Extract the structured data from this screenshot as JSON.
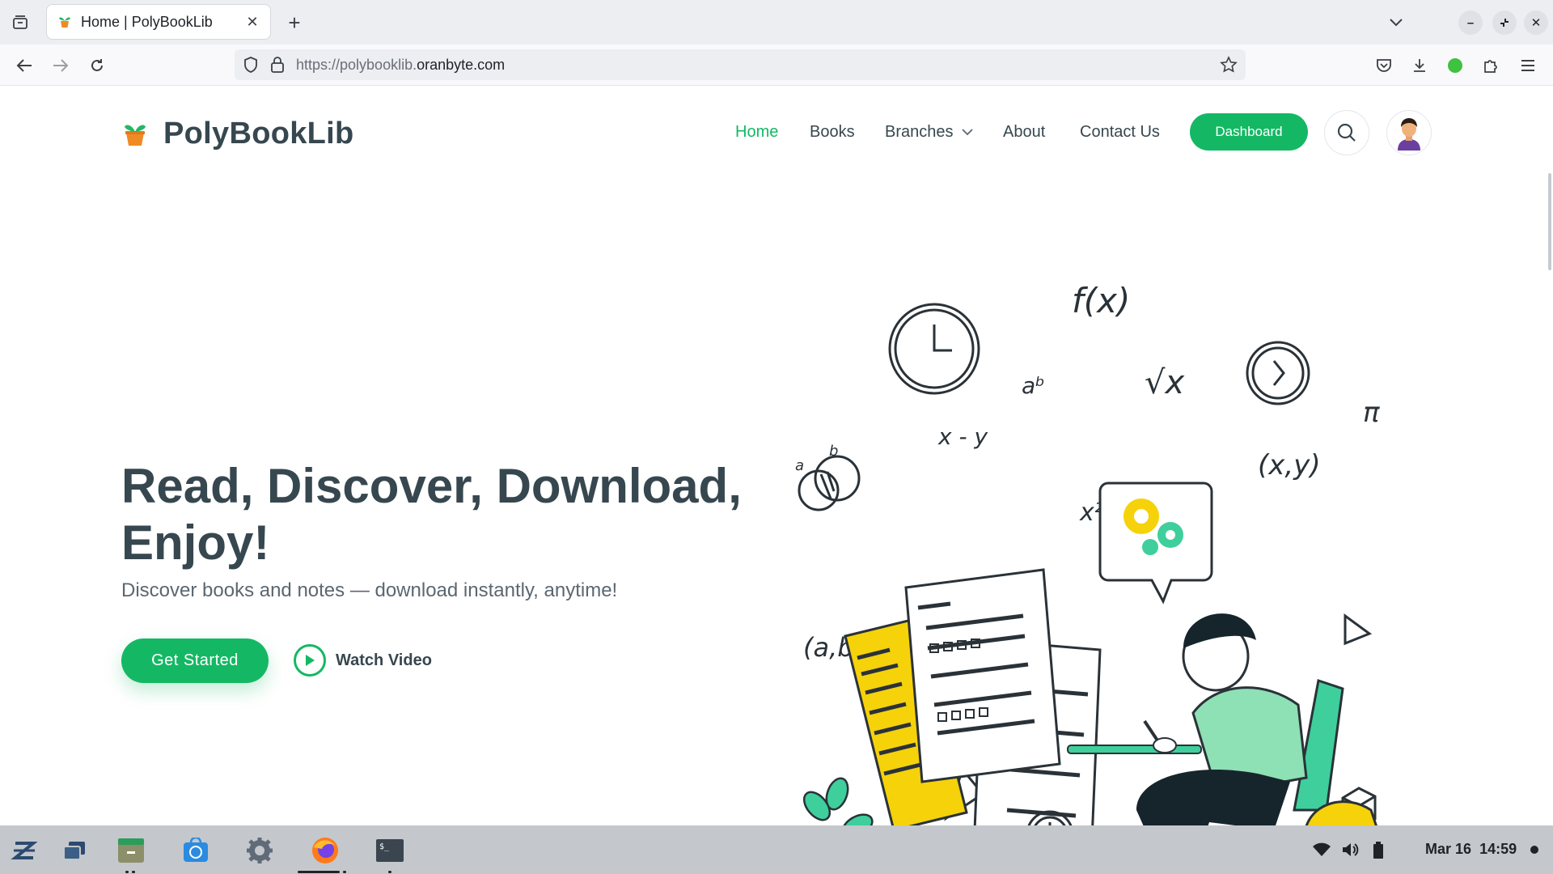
{
  "browser": {
    "tab_title": "Home | PolyBookLib",
    "url_prefix": "https://polybooklib.",
    "url_domain": "oranbyte.com"
  },
  "site": {
    "brand": "PolyBookLib",
    "nav": {
      "home": "Home",
      "books": "Books",
      "branches": "Branches",
      "about": "About",
      "contact": "Contact Us",
      "dashboard": "Dashboard"
    },
    "hero": {
      "title_line1": "Read, Discover, Download,",
      "title_line2": "Enjoy!",
      "subtitle": "Discover books and notes — download instantly, anytime!",
      "cta": "Get Started",
      "watch": "Watch Video"
    },
    "accent_color": "#14b864"
  },
  "illustration": {
    "formulas": {
      "fx": "f(x)",
      "sqrt": "√x",
      "ab": "aᵇ",
      "xy": "x - y",
      "x2": "x²",
      "pi": "π",
      "pair": "(x,y)",
      "ab_pair": "(a,b)",
      "a": "a",
      "b": "b"
    }
  },
  "taskbar": {
    "date": "Mar 16",
    "time": "14:59"
  }
}
